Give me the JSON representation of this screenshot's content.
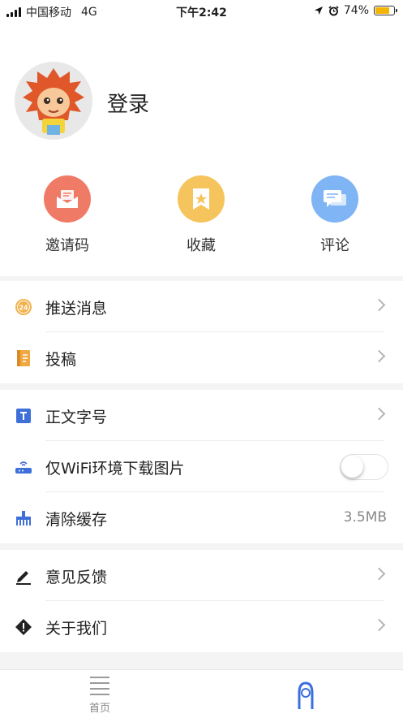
{
  "status_bar": {
    "carrier": "中国移动",
    "network": "4G",
    "time": "下午2:42",
    "battery_percent": "74%",
    "battery_level": 0.74,
    "icons": [
      "location-icon",
      "alarm-icon"
    ]
  },
  "profile": {
    "login_label": "登录",
    "avatar_icon": "lion-mascot-avatar"
  },
  "shortcuts": [
    {
      "label": "邀请码",
      "icon": "envelope-icon",
      "color": "#ef7b66"
    },
    {
      "label": "收藏",
      "icon": "bookmark-star-icon",
      "color": "#f6c45c"
    },
    {
      "label": "评论",
      "icon": "comment-bubbles-icon",
      "color": "#7fb4f5"
    }
  ],
  "menu_group1": [
    {
      "label": "推送消息",
      "icon": "24-hour-icon"
    },
    {
      "label": "投稿",
      "icon": "notebook-icon"
    }
  ],
  "menu_group2": [
    {
      "label": "正文字号",
      "icon": "text-size-icon"
    },
    {
      "label": "仅WiFi环境下载图片",
      "icon": "router-icon",
      "toggle_on": false
    },
    {
      "label": "清除缓存",
      "icon": "broom-icon",
      "value": "3.5MB"
    }
  ],
  "menu_group3": [
    {
      "label": "意见反馈",
      "icon": "pencil-icon"
    },
    {
      "label": "关于我们",
      "icon": "info-diamond-icon"
    }
  ],
  "tab_bar": {
    "home_label": "首页",
    "colors": {
      "home": "#9a9a9a",
      "me_active": "#3b6fe0"
    }
  }
}
